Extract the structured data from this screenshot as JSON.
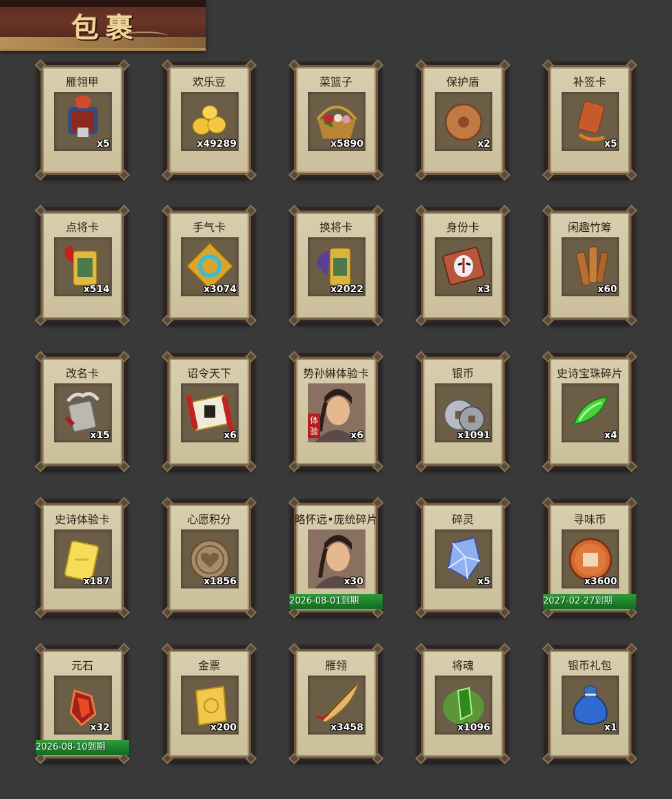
{
  "header": {
    "title": "包裹"
  },
  "items": [
    {
      "name": "雁翎甲",
      "count": "x5",
      "icon": "armor-icon"
    },
    {
      "name": "欢乐豆",
      "count": "x49289",
      "icon": "gold-beans-icon"
    },
    {
      "name": "菜篮子",
      "count": "x5890",
      "icon": "basket-icon"
    },
    {
      "name": "保护盾",
      "count": "x2",
      "icon": "shield-icon"
    },
    {
      "name": "补签卡",
      "count": "x5",
      "icon": "sign-card-icon"
    },
    {
      "name": "点将卡",
      "count": "x514",
      "icon": "general-card-icon"
    },
    {
      "name": "手气卡",
      "count": "x3074",
      "icon": "luck-card-icon"
    },
    {
      "name": "换将卡",
      "count": "x2022",
      "icon": "swap-card-icon"
    },
    {
      "name": "身份卡",
      "count": "x3",
      "icon": "identity-card-icon"
    },
    {
      "name": "闲趣竹筹",
      "count": "x60",
      "icon": "bamboo-token-icon"
    },
    {
      "name": "改名卡",
      "count": "x15",
      "icon": "rename-card-icon"
    },
    {
      "name": "诏令天下",
      "count": "x6",
      "icon": "scroll-icon"
    },
    {
      "name": "势孙綝体验卡",
      "count": "x6",
      "icon": "hero-portrait-icon",
      "tag": "体验"
    },
    {
      "name": "银币",
      "count": "x1091",
      "icon": "silver-coin-icon"
    },
    {
      "name": "史诗宝珠碎片",
      "count": "x4",
      "icon": "green-shard-icon"
    },
    {
      "name": "史诗体验卡",
      "count": "x187",
      "icon": "gold-card-icon"
    },
    {
      "name": "心愿积分",
      "count": "x1856",
      "icon": "heart-coin-icon"
    },
    {
      "name": "略怀远•庞统碎片",
      "count": "x30",
      "icon": "hero-portrait-icon",
      "expiry": "2026-08-01到期"
    },
    {
      "name": "碎灵",
      "count": "x5",
      "icon": "crystal-icon"
    },
    {
      "name": "寻味币",
      "count": "x3600",
      "icon": "taste-coin-icon",
      "expiry": "2027-02-27到期"
    },
    {
      "name": "元石",
      "count": "x32",
      "icon": "red-stone-icon",
      "expiry": "2026-08-10到期"
    },
    {
      "name": "金票",
      "count": "x200",
      "icon": "gold-ticket-icon"
    },
    {
      "name": "雁翎",
      "count": "x3458",
      "icon": "feather-icon"
    },
    {
      "name": "将魂",
      "count": "x1096",
      "icon": "soul-crystal-icon"
    },
    {
      "name": "银币礼包",
      "count": "x1",
      "icon": "money-bag-icon"
    }
  ],
  "colors": {
    "background": "#393939",
    "card_paper": "#d8ceae",
    "expiry_green": "#1f8a2e",
    "trial_red": "#b41d1d"
  }
}
